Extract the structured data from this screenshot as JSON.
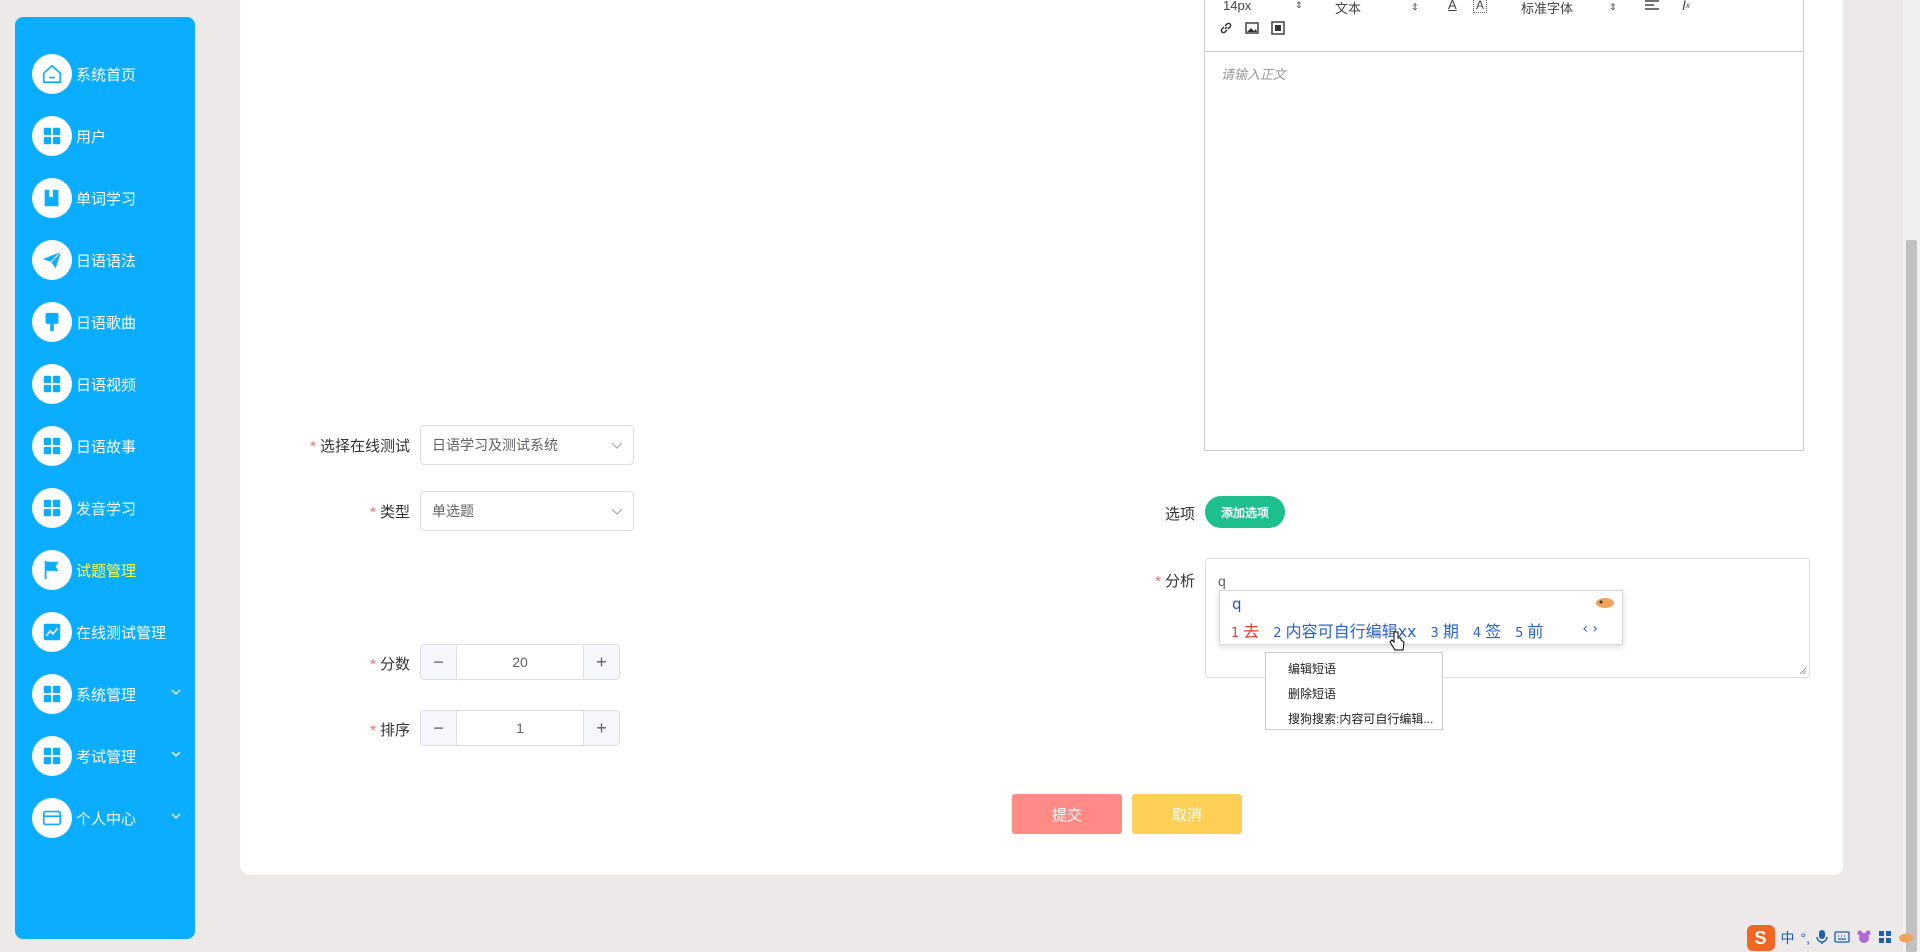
{
  "sidebar": {
    "items": [
      {
        "label": "系统首页",
        "icon": "home-icon"
      },
      {
        "label": "用户",
        "icon": "grid-icon"
      },
      {
        "label": "单词学习",
        "icon": "book-icon"
      },
      {
        "label": "日语语法",
        "icon": "send-icon"
      },
      {
        "label": "日语歌曲",
        "icon": "brush-icon"
      },
      {
        "label": "日语视频",
        "icon": "grid-icon"
      },
      {
        "label": "日语故事",
        "icon": "grid-icon"
      },
      {
        "label": "发音学习",
        "icon": "grid-icon"
      },
      {
        "label": "试题管理",
        "icon": "flag-icon",
        "active": true
      },
      {
        "label": "在线测试管理",
        "icon": "chart-icon"
      },
      {
        "label": "系统管理",
        "icon": "grid-icon",
        "expandable": true
      },
      {
        "label": "考试管理",
        "icon": "grid-icon",
        "expandable": true
      },
      {
        "label": "个人中心",
        "icon": "wallet-icon",
        "expandable": true
      }
    ]
  },
  "form": {
    "online_test": {
      "label": "选择在线测试",
      "value": "日语学习及测试系统"
    },
    "type": {
      "label": "类型",
      "value": "单选题"
    },
    "score": {
      "label": "分数",
      "value": "20"
    },
    "order": {
      "label": "排序",
      "value": "1"
    },
    "options": {
      "label": "选项",
      "add_button": "添加选项"
    },
    "analysis": {
      "label": "分析",
      "value": "q"
    }
  },
  "editor": {
    "font_size": "14px",
    "block_type": "文本",
    "font_family": "标准字体",
    "placeholder": "请输入正文"
  },
  "buttons": {
    "submit": "提交",
    "cancel": "取消"
  },
  "ime": {
    "input": "q",
    "candidates": [
      {
        "n": "1",
        "text": "去"
      },
      {
        "n": "2",
        "text": "内容可自行编辑xx"
      },
      {
        "n": "3",
        "text": "期"
      },
      {
        "n": "4",
        "text": "签"
      },
      {
        "n": "5",
        "text": "前"
      }
    ],
    "nav": "‹ ›",
    "context_menu": [
      "编辑短语",
      "删除短语",
      "搜狗搜索:内容可自行编辑..."
    ]
  },
  "tray": {
    "logo": "S",
    "lang": "中",
    "punct": "°,"
  },
  "colors": {
    "sidebar_bg": "#0aadff",
    "active_nav": "#ffff3b",
    "submit": "#ff8a86",
    "cancel": "#ffd056",
    "add_option": "#1ebf8e",
    "required": "#f56c6c"
  }
}
